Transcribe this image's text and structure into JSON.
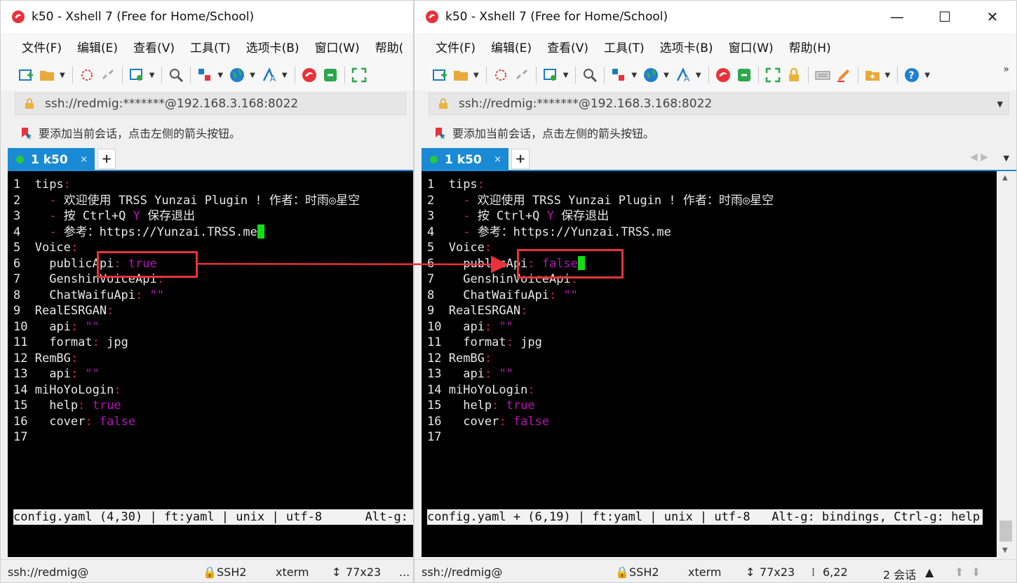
{
  "left_window": {
    "title": "k50 - Xshell 7 (Free for Home/School)",
    "menu": [
      "文件(F)",
      "编辑(E)",
      "查看(V)",
      "工具(T)",
      "选项卡(B)",
      "窗口(W)",
      "帮助("
    ],
    "address": "ssh://redmig:*******@192.168.3.168:8022",
    "hint": "要添加当前会话，点击左侧的箭头按钮。",
    "tab_label": "1 k50",
    "tab_close": "×",
    "tab_add": "+",
    "editor_lines": [
      {
        "num": "1 ",
        "text": "tips",
        "colon": ":"
      },
      {
        "num": "2 ",
        "prefix": "  ",
        "dash": "- ",
        "text": "欢迎使用 TRSS Yunzai Plugin ! 作者：时雨◎星空"
      },
      {
        "num": "3 ",
        "prefix": "  ",
        "dash": "- ",
        "text": "按 Ctrl+Q ",
        "mag": "Y",
        "text2": " 保存退出"
      },
      {
        "num": "4 ",
        "prefix": "  ",
        "dash": "- ",
        "text": "参考：https://Yunzai.TRSS.me"
      },
      {
        "num": "5 ",
        "text": "Voice",
        "colon": ":"
      },
      {
        "num": "6 ",
        "prefix": "  ",
        "text": "publicApi",
        "colon": ": ",
        "val": "true"
      },
      {
        "num": "7 ",
        "prefix": "  ",
        "text": "GenshinVoiceApi",
        "colon": ":"
      },
      {
        "num": "8 ",
        "prefix": "  ",
        "text": "ChatWaifuApi",
        "colon": ": ",
        "val": "\"\""
      },
      {
        "num": "9 ",
        "text": "RealESRGAN",
        "colon": ":"
      },
      {
        "num": "10",
        "prefix": "  ",
        "text": "api",
        "colon": ": ",
        "val": "\"\""
      },
      {
        "num": "11",
        "prefix": "  ",
        "text": "format",
        "colon": ": ",
        "plain": "jpg"
      },
      {
        "num": "12",
        "text": "RemBG",
        "colon": ":"
      },
      {
        "num": "13",
        "prefix": "  ",
        "text": "api",
        "colon": ": ",
        "val": "\"\""
      },
      {
        "num": "14",
        "text": "miHoYoLogin",
        "colon": ":"
      },
      {
        "num": "15",
        "prefix": "  ",
        "text": "help",
        "colon": ": ",
        "val": "true"
      },
      {
        "num": "16",
        "prefix": "  ",
        "text": "cover",
        "colon": ": ",
        "val": "false"
      },
      {
        "num": "17",
        "text": ""
      }
    ],
    "status_line": "config.yaml (4,30) | ft:yaml | unix | utf-8      Alt-g:",
    "statusbar": {
      "conn": "ssh://redmig@",
      "proto": "SSH2",
      "term": "xterm",
      "size": "77x23",
      "cut": "..."
    }
  },
  "right_window": {
    "title": "k50 - Xshell 7 (Free for Home/School)",
    "menu": [
      "文件(F)",
      "编辑(E)",
      "查看(V)",
      "工具(T)",
      "选项卡(B)",
      "窗口(W)",
      "帮助(H)"
    ],
    "address": "ssh://redmig:*******@192.168.3.168:8022",
    "hint": "要添加当前会话，点击左侧的箭头按钮。",
    "tab_label": "1 k50",
    "tab_close": "×",
    "tab_add": "+",
    "line6_value": "false",
    "status_line": "config.yaml + (6,19) | ft:yaml | unix | utf-8   Alt-g: bindings, Ctrl-g: help",
    "statusbar": {
      "conn": "ssh://redmig@",
      "proto": "SSH2",
      "term": "xterm",
      "size": "77x23",
      "pos": "6,22",
      "sessions": "2 会话"
    }
  },
  "window_controls": {
    "minimize": "—",
    "maximize": "☐",
    "close": "✕"
  },
  "colors": {
    "tab_blue": "#1a8ad4",
    "highlight_red": "#e8323a",
    "cursor_green": "#11e011",
    "yaml_key_red": "#cd2b2b",
    "yaml_value_magenta": "#b414b4"
  },
  "icons": [
    "xshell-logo-icon",
    "new-session-icon",
    "open-folder-icon",
    "connect-icon",
    "disconnect-icon",
    "properties-icon",
    "find-icon",
    "transfer-icon",
    "globe-icon",
    "font-icon",
    "xshell-icon",
    "xftp-icon",
    "fullscreen-icon",
    "lock-icon",
    "keyboard-icon",
    "highlight-icon",
    "new-tab-icon",
    "help-icon"
  ]
}
